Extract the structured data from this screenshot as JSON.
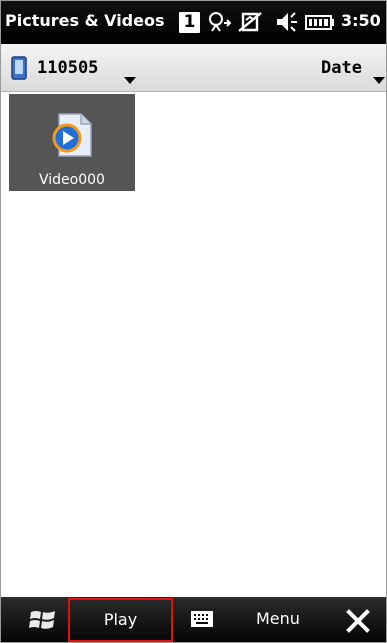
{
  "title_bar": {
    "app_title": "Pictures & Videos",
    "notification_count": "1",
    "clock": "3:50",
    "icons": [
      "connectivity-icon",
      "no-sync-icon",
      "volume-icon",
      "battery-icon"
    ]
  },
  "toolbar": {
    "folder_label": "110505",
    "folder_icon": "storage-card-icon",
    "sort_label": "Date"
  },
  "items": [
    {
      "label": "Video000",
      "icon": "windows-media-video-icon",
      "selected": true
    }
  ],
  "bottom_bar": {
    "start_icon": "windows-start-icon",
    "left_softkey": "Play",
    "keyboard_icon": "keyboard-icon",
    "right_softkey": "Menu",
    "close_icon": "close-icon"
  },
  "colors": {
    "title_bar_bg": "#000000",
    "selection_bg": "#555555",
    "highlight_border": "#e01010"
  }
}
